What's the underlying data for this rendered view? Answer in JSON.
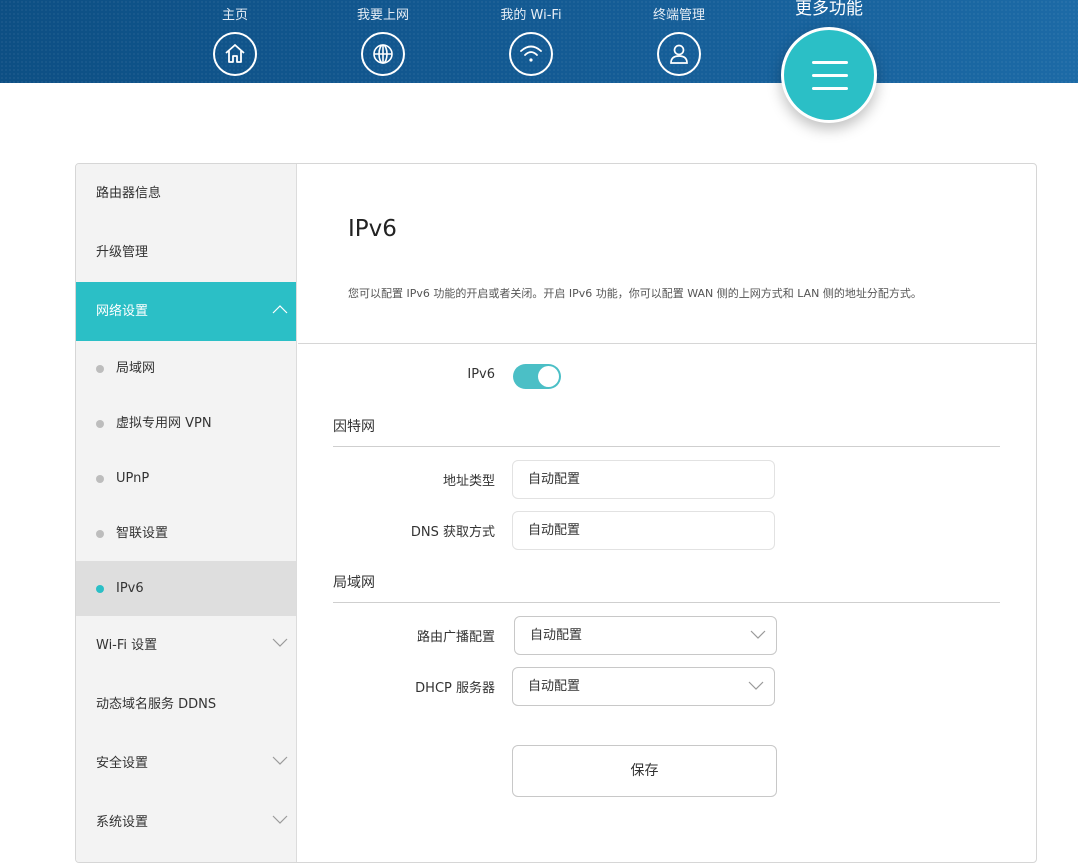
{
  "nav": {
    "items": [
      {
        "label": "主页",
        "icon": "home-icon"
      },
      {
        "label": "我要上网",
        "icon": "globe-icon"
      },
      {
        "label": "我的 Wi-Fi",
        "icon": "wifi-icon"
      },
      {
        "label": "终端管理",
        "icon": "user-icon"
      }
    ],
    "more_label": "更多功能",
    "more_icon": "menu-icon"
  },
  "sidebar": {
    "items": [
      {
        "label": "路由器信息"
      },
      {
        "label": "升级管理"
      },
      {
        "label": "网络设置"
      }
    ],
    "sub_items": [
      {
        "label": "局域网"
      },
      {
        "label": "虚拟专用网 VPN"
      },
      {
        "label": "UPnP"
      },
      {
        "label": "智联设置"
      },
      {
        "label": "IPv6"
      }
    ],
    "after_items": [
      {
        "label": "Wi-Fi 设置"
      },
      {
        "label": "动态域名服务 DDNS"
      },
      {
        "label": "安全设置"
      },
      {
        "label": "系统设置"
      }
    ]
  },
  "content": {
    "title": "IPv6",
    "description": "您可以配置 IPv6 功能的开启或者关闭。开启 IPv6 功能，你可以配置 WAN 侧的上网方式和 LAN 侧的地址分配方式。",
    "ipv6_label": "IPv6",
    "ipv6_enabled": true,
    "internet_section": "因特网",
    "address_type_label": "地址类型",
    "address_type_value": "自动配置",
    "dns_label": "DNS 获取方式",
    "dns_value": "自动配置",
    "lan_section": "局域网",
    "router_adv_label": "路由广播配置",
    "router_adv_value": "自动配置",
    "dhcp_label": "DHCP 服务器",
    "dhcp_value": "自动配置",
    "save_label": "保存"
  },
  "colors": {
    "accent": "#2bbfc6",
    "nav_bg": "#145b95"
  }
}
